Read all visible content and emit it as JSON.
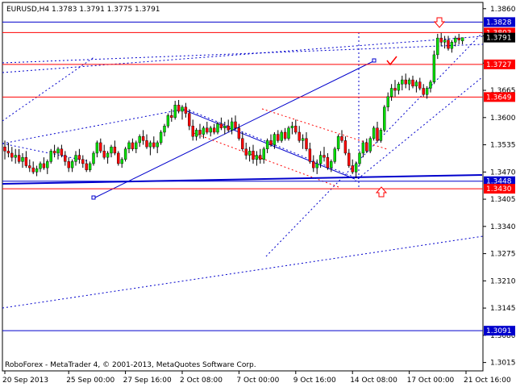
{
  "window": {
    "symbol_line": "EURUSD,H4  1.3783 1.3791 1.3775 1.3791",
    "copyright": "RoboForex - MetaTrader 4, © 2001-2013, MetaQuotes Software Corp."
  },
  "colors": {
    "bull": "#00dd00",
    "bear": "#ff0000",
    "wick": "#000000",
    "resistance": "#ff0000",
    "trend": "#0000cc",
    "grid": "#000000",
    "badge_blue": "#0000cc",
    "badge_red": "#ff0000"
  },
  "chart_data": {
    "type": "candlestick",
    "timeframe": "H4",
    "ylim": [
      1.2995,
      1.3875
    ],
    "y_ticks": [
      "1.3860",
      "1.3795",
      "1.3730",
      "1.3665",
      "1.3600",
      "1.3535",
      "1.3470",
      "1.3405",
      "1.3340",
      "1.3275",
      "1.3210",
      "1.3145",
      "1.3080",
      "1.3015"
    ],
    "x_ticks": [
      "20 Sep 2013",
      "25 Sep 00:00",
      "27 Sep 16:00",
      "2 Oct 08:00",
      "7 Oct 00:00",
      "9 Oct 16:00",
      "14 Oct 08:00",
      "17 Oct 00:00",
      "21 Oct 16:00"
    ],
    "x_tick_index": [
      0,
      18,
      34,
      50,
      66,
      82,
      98,
      114,
      130
    ],
    "current_price": "1.3791",
    "price_labels": [
      {
        "value": 1.3828,
        "text": "1.3828",
        "style": "blue-line"
      },
      {
        "value": 1.3803,
        "text": "1.3803",
        "style": "red-line"
      },
      {
        "value": 1.3727,
        "text": "1.3727",
        "style": "red-line"
      },
      {
        "value": 1.3649,
        "text": "1.3649",
        "style": "red-line"
      },
      {
        "value": 1.3448,
        "text": "1.3448",
        "style": "blue-line"
      },
      {
        "value": 1.343,
        "text": "1.3430",
        "style": "red-line"
      },
      {
        "value": 1.3091,
        "text": "1.3091",
        "style": "blue-line"
      }
    ],
    "candles": [
      [
        1.353,
        1.3545,
        1.35,
        1.352
      ],
      [
        1.352,
        1.354,
        1.3505,
        1.3515
      ],
      [
        1.3515,
        1.353,
        1.3495,
        1.3505
      ],
      [
        1.3505,
        1.3525,
        1.349,
        1.351
      ],
      [
        1.351,
        1.3525,
        1.349,
        1.3495
      ],
      [
        1.3495,
        1.3515,
        1.348,
        1.3505
      ],
      [
        1.3505,
        1.352,
        1.348,
        1.3485
      ],
      [
        1.3485,
        1.35,
        1.347,
        1.348
      ],
      [
        1.348,
        1.3495,
        1.3465,
        1.347
      ],
      [
        1.347,
        1.3485,
        1.346,
        1.3478
      ],
      [
        1.3478,
        1.3495,
        1.347,
        1.349
      ],
      [
        1.349,
        1.3505,
        1.3475,
        1.348
      ],
      [
        1.348,
        1.35,
        1.3465,
        1.3495
      ],
      [
        1.3495,
        1.3525,
        1.349,
        1.352
      ],
      [
        1.352,
        1.3535,
        1.3505,
        1.3515
      ],
      [
        1.3515,
        1.353,
        1.35,
        1.3525
      ],
      [
        1.3525,
        1.3535,
        1.3505,
        1.351
      ],
      [
        1.351,
        1.352,
        1.3485,
        1.3495
      ],
      [
        1.3495,
        1.3505,
        1.347,
        1.348
      ],
      [
        1.348,
        1.35,
        1.347,
        1.3495
      ],
      [
        1.3495,
        1.352,
        1.3485,
        1.351
      ],
      [
        1.351,
        1.3525,
        1.349,
        1.35
      ],
      [
        1.35,
        1.351,
        1.348,
        1.349
      ],
      [
        1.349,
        1.35,
        1.347,
        1.3475
      ],
      [
        1.3475,
        1.3495,
        1.347,
        1.349
      ],
      [
        1.349,
        1.352,
        1.3485,
        1.3515
      ],
      [
        1.3515,
        1.3545,
        1.3505,
        1.354
      ],
      [
        1.354,
        1.355,
        1.3515,
        1.352
      ],
      [
        1.352,
        1.3535,
        1.35,
        1.3505
      ],
      [
        1.3505,
        1.352,
        1.349,
        1.3515
      ],
      [
        1.3515,
        1.3535,
        1.3505,
        1.353
      ],
      [
        1.353,
        1.3545,
        1.351,
        1.3515
      ],
      [
        1.3515,
        1.352,
        1.3485,
        1.349
      ],
      [
        1.349,
        1.3505,
        1.348,
        1.35
      ],
      [
        1.35,
        1.353,
        1.3495,
        1.3525
      ],
      [
        1.3525,
        1.3545,
        1.3515,
        1.354
      ],
      [
        1.354,
        1.355,
        1.352,
        1.3525
      ],
      [
        1.3525,
        1.3545,
        1.3515,
        1.354
      ],
      [
        1.354,
        1.356,
        1.353,
        1.3555
      ],
      [
        1.3555,
        1.357,
        1.3535,
        1.3545
      ],
      [
        1.3545,
        1.356,
        1.3525,
        1.353
      ],
      [
        1.353,
        1.3545,
        1.351,
        1.354
      ],
      [
        1.354,
        1.3555,
        1.3525,
        1.353
      ],
      [
        1.353,
        1.3545,
        1.3515,
        1.354
      ],
      [
        1.354,
        1.357,
        1.3535,
        1.3565
      ],
      [
        1.3565,
        1.3585,
        1.3555,
        1.358
      ],
      [
        1.358,
        1.361,
        1.3575,
        1.3605
      ],
      [
        1.3605,
        1.362,
        1.359,
        1.36
      ],
      [
        1.36,
        1.364,
        1.3595,
        1.363
      ],
      [
        1.363,
        1.3642,
        1.361,
        1.3615
      ],
      [
        1.3615,
        1.363,
        1.3595,
        1.3625
      ],
      [
        1.3625,
        1.3635,
        1.36,
        1.361
      ],
      [
        1.361,
        1.362,
        1.357,
        1.358
      ],
      [
        1.358,
        1.3595,
        1.3545,
        1.3555
      ],
      [
        1.3555,
        1.3575,
        1.3545,
        1.357
      ],
      [
        1.357,
        1.3585,
        1.355,
        1.356
      ],
      [
        1.356,
        1.358,
        1.355,
        1.3575
      ],
      [
        1.3575,
        1.359,
        1.356,
        1.3565
      ],
      [
        1.3565,
        1.358,
        1.3555,
        1.3575
      ],
      [
        1.3575,
        1.3585,
        1.356,
        1.3565
      ],
      [
        1.3565,
        1.359,
        1.356,
        1.3585
      ],
      [
        1.3585,
        1.36,
        1.357,
        1.3575
      ],
      [
        1.3575,
        1.359,
        1.356,
        1.358
      ],
      [
        1.358,
        1.3595,
        1.3565,
        1.357
      ],
      [
        1.357,
        1.36,
        1.356,
        1.359
      ],
      [
        1.359,
        1.3605,
        1.357,
        1.3575
      ],
      [
        1.3575,
        1.3585,
        1.3545,
        1.355
      ],
      [
        1.355,
        1.3565,
        1.352,
        1.3525
      ],
      [
        1.3525,
        1.354,
        1.35,
        1.351
      ],
      [
        1.351,
        1.353,
        1.3495,
        1.352
      ],
      [
        1.352,
        1.3535,
        1.349,
        1.35
      ],
      [
        1.35,
        1.352,
        1.3485,
        1.351
      ],
      [
        1.351,
        1.3525,
        1.349,
        1.35
      ],
      [
        1.35,
        1.353,
        1.349,
        1.3525
      ],
      [
        1.3525,
        1.355,
        1.3515,
        1.3545
      ],
      [
        1.3545,
        1.356,
        1.353,
        1.3535
      ],
      [
        1.3535,
        1.3565,
        1.3525,
        1.356
      ],
      [
        1.356,
        1.357,
        1.354,
        1.3545
      ],
      [
        1.3545,
        1.357,
        1.354,
        1.3565
      ],
      [
        1.3565,
        1.3575,
        1.3545,
        1.355
      ],
      [
        1.355,
        1.358,
        1.3545,
        1.3575
      ],
      [
        1.3575,
        1.359,
        1.356,
        1.358
      ],
      [
        1.358,
        1.3595,
        1.356,
        1.3565
      ],
      [
        1.3565,
        1.358,
        1.354,
        1.3545
      ],
      [
        1.3545,
        1.356,
        1.3525,
        1.355
      ],
      [
        1.355,
        1.3565,
        1.352,
        1.3525
      ],
      [
        1.3525,
        1.354,
        1.349,
        1.3495
      ],
      [
        1.3495,
        1.351,
        1.347,
        1.348
      ],
      [
        1.348,
        1.35,
        1.3465,
        1.349
      ],
      [
        1.349,
        1.352,
        1.348,
        1.351
      ],
      [
        1.351,
        1.353,
        1.3495,
        1.3505
      ],
      [
        1.3505,
        1.3515,
        1.3475,
        1.348
      ],
      [
        1.348,
        1.35,
        1.347,
        1.3495
      ],
      [
        1.3495,
        1.353,
        1.349,
        1.3525
      ],
      [
        1.3525,
        1.356,
        1.352,
        1.3555
      ],
      [
        1.3555,
        1.357,
        1.354,
        1.3545
      ],
      [
        1.3545,
        1.3555,
        1.351,
        1.3515
      ],
      [
        1.3515,
        1.3525,
        1.348,
        1.3485
      ],
      [
        1.3485,
        1.35,
        1.3465,
        1.347
      ],
      [
        1.347,
        1.3495,
        1.3455,
        1.349
      ],
      [
        1.349,
        1.352,
        1.3485,
        1.3515
      ],
      [
        1.3515,
        1.3545,
        1.3505,
        1.354
      ],
      [
        1.354,
        1.355,
        1.3515,
        1.352
      ],
      [
        1.352,
        1.3555,
        1.3515,
        1.355
      ],
      [
        1.355,
        1.358,
        1.3545,
        1.3575
      ],
      [
        1.3575,
        1.359,
        1.354,
        1.3545
      ],
      [
        1.3545,
        1.3575,
        1.354,
        1.357
      ],
      [
        1.357,
        1.363,
        1.3565,
        1.3625
      ],
      [
        1.3625,
        1.366,
        1.3615,
        1.365
      ],
      [
        1.365,
        1.368,
        1.364,
        1.367
      ],
      [
        1.367,
        1.369,
        1.365,
        1.3665
      ],
      [
        1.3665,
        1.3685,
        1.3655,
        1.368
      ],
      [
        1.368,
        1.37,
        1.3665,
        1.369
      ],
      [
        1.369,
        1.3705,
        1.367,
        1.368
      ],
      [
        1.368,
        1.3695,
        1.3665,
        1.369
      ],
      [
        1.369,
        1.37,
        1.367,
        1.3675
      ],
      [
        1.3675,
        1.369,
        1.366,
        1.3685
      ],
      [
        1.3685,
        1.3695,
        1.3665,
        1.367
      ],
      [
        1.367,
        1.368,
        1.365,
        1.3655
      ],
      [
        1.3655,
        1.3675,
        1.3645,
        1.367
      ],
      [
        1.367,
        1.369,
        1.366,
        1.3685
      ],
      [
        1.3685,
        1.376,
        1.368,
        1.375
      ],
      [
        1.375,
        1.38,
        1.374,
        1.379
      ],
      [
        1.379,
        1.3802,
        1.377,
        1.378
      ],
      [
        1.378,
        1.3795,
        1.3765,
        1.3785
      ],
      [
        1.3785,
        1.3795,
        1.376,
        1.3765
      ],
      [
        1.3765,
        1.3785,
        1.3755,
        1.378
      ],
      [
        1.378,
        1.3795,
        1.377,
        1.379
      ],
      [
        1.379,
        1.38,
        1.3775,
        1.3785
      ],
      [
        1.3783,
        1.3791,
        1.3775,
        1.3791
      ]
    ],
    "candle_format": [
      "open",
      "high",
      "low",
      "close"
    ]
  }
}
